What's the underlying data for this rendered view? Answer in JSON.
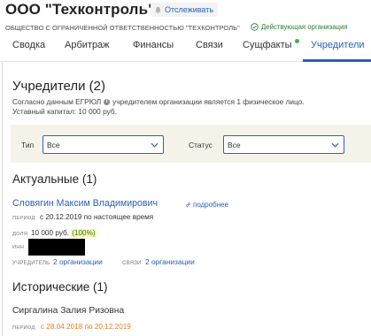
{
  "header": {
    "company_title": "ООО \"Техконтроль\"",
    "follow_label": "Отслеживать",
    "legal_name": "ОБЩЕСТВО С ОГРАНИЧЕННОЙ ОТВЕТСТВЕННОСТЬЮ \"ТЕХКОНТРОЛЬ\"",
    "status": "Действующая организация",
    "status_color": "#2e7d32"
  },
  "tabs": [
    {
      "label": "Сводка",
      "active": false
    },
    {
      "label": "Арбитраж",
      "active": false
    },
    {
      "label": "Финансы",
      "active": false
    },
    {
      "label": "Связи",
      "active": false
    },
    {
      "label": "Сущфакты",
      "active": false,
      "has_new_indicator": true
    },
    {
      "label": "Учредители",
      "active": true
    }
  ],
  "founders": {
    "title": "Учредители (2)",
    "info": "Согласно данным ЕГРЮЛ",
    "info_rest": "учредителем организации является 1 физическое лицо.",
    "capital": "Уставный капитал: 10 000 руб."
  },
  "filters": {
    "type_label": "Тип",
    "type_value": "Все",
    "status_label": "Статус",
    "status_value": "Все"
  },
  "current": {
    "heading": "Актуальные (1)",
    "person": {
      "name": "Словягин Максим Владимирович",
      "more_link": "подробнее",
      "period_label": "ПЕРИОД",
      "period_value": "с 20.12.2019 по настоящее время",
      "share_label": "ДОЛЯ",
      "share_value": "10 000 руб.",
      "share_percent": "(100%)",
      "inn_label": "ИНН",
      "founder_label": "УЧРЕДИТЕЛЬ",
      "founder_link": "2 организации",
      "links_label": "СВЯЗИ",
      "links_link": "2 организации"
    }
  },
  "historical": {
    "heading": "Исторические (1)",
    "person": {
      "name": "Сиргалина Залия Ризовна",
      "period_label": "ПЕРИОД",
      "period_value": "с 28.04.2018 по 20.12.2019"
    }
  },
  "colors": {
    "link": "#2a62b8",
    "historic_date": "#e67e22",
    "filter_bg": "#f5f3e9"
  }
}
